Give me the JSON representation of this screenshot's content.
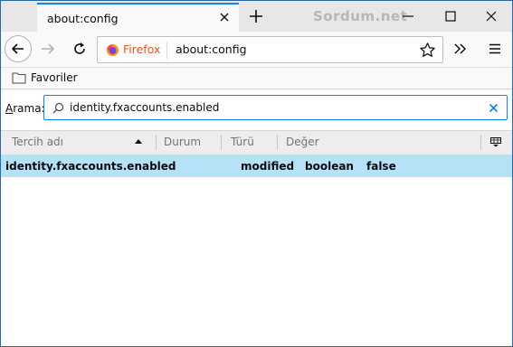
{
  "tab": {
    "title": "about:config"
  },
  "watermark": "Sordum.net",
  "urlbar": {
    "identity_label": "Firefox",
    "url": "about:config"
  },
  "bookmarks": [
    {
      "label": "Favoriler"
    }
  ],
  "search": {
    "label_prefix": "A",
    "label_rest": "rama:",
    "value": "identity.fxaccounts.enabled"
  },
  "table": {
    "columns": [
      "Tercih adı",
      "Durum",
      "Türü",
      "Değer"
    ],
    "sorted_column": "Tercih adı",
    "sort_direction": "ascending",
    "rows": [
      {
        "name": "identity.fxaccounts.enabled",
        "status": "modified",
        "type": "boolean",
        "value": "false",
        "selected": true
      }
    ]
  },
  "colors": {
    "accent": "#0a84ff",
    "selected_row": "#b6e2f7",
    "firefox_label": "#e15722"
  },
  "icons": [
    "back-arrow-icon",
    "forward-arrow-icon",
    "reload-icon",
    "firefox-logo-icon",
    "star-icon",
    "overflow-icon",
    "hamburger-menu-icon",
    "folder-icon",
    "search-icon",
    "clear-icon",
    "column-picker-icon",
    "close-icon",
    "plus-icon",
    "minimize-icon",
    "maximize-icon"
  ]
}
